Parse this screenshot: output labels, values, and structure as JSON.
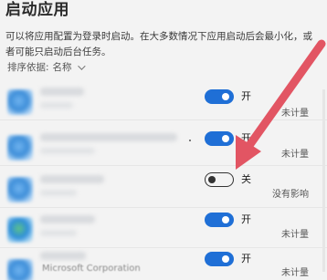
{
  "page": {
    "title": "启动应用",
    "description": "可以将应用配置为登录时启动。在大多数情况下应用启动后会最小化，或者可能只启动后台任务。",
    "sort_label": "排序依据:",
    "sort_value": "名称"
  },
  "apps": [
    {
      "state_label": "开",
      "impact": "未计量",
      "enabled": true
    },
    {
      "state_label": "开",
      "impact": "未计量",
      "enabled": true
    },
    {
      "state_label": "关",
      "impact": "没有影响",
      "enabled": false
    },
    {
      "state_label": "开",
      "impact": "未计量",
      "enabled": true
    },
    {
      "state_label": "开",
      "impact": "未计量",
      "enabled": true,
      "publisher": "Microsoft Corporation"
    }
  ],
  "colors": {
    "toggle_on": "#1f6fd6",
    "arrow": "#e25563",
    "background": "#f3f3f3"
  },
  "icons": {
    "sort": "chevron-down-icon",
    "arrow": "red-arrow-annotation-icon"
  }
}
